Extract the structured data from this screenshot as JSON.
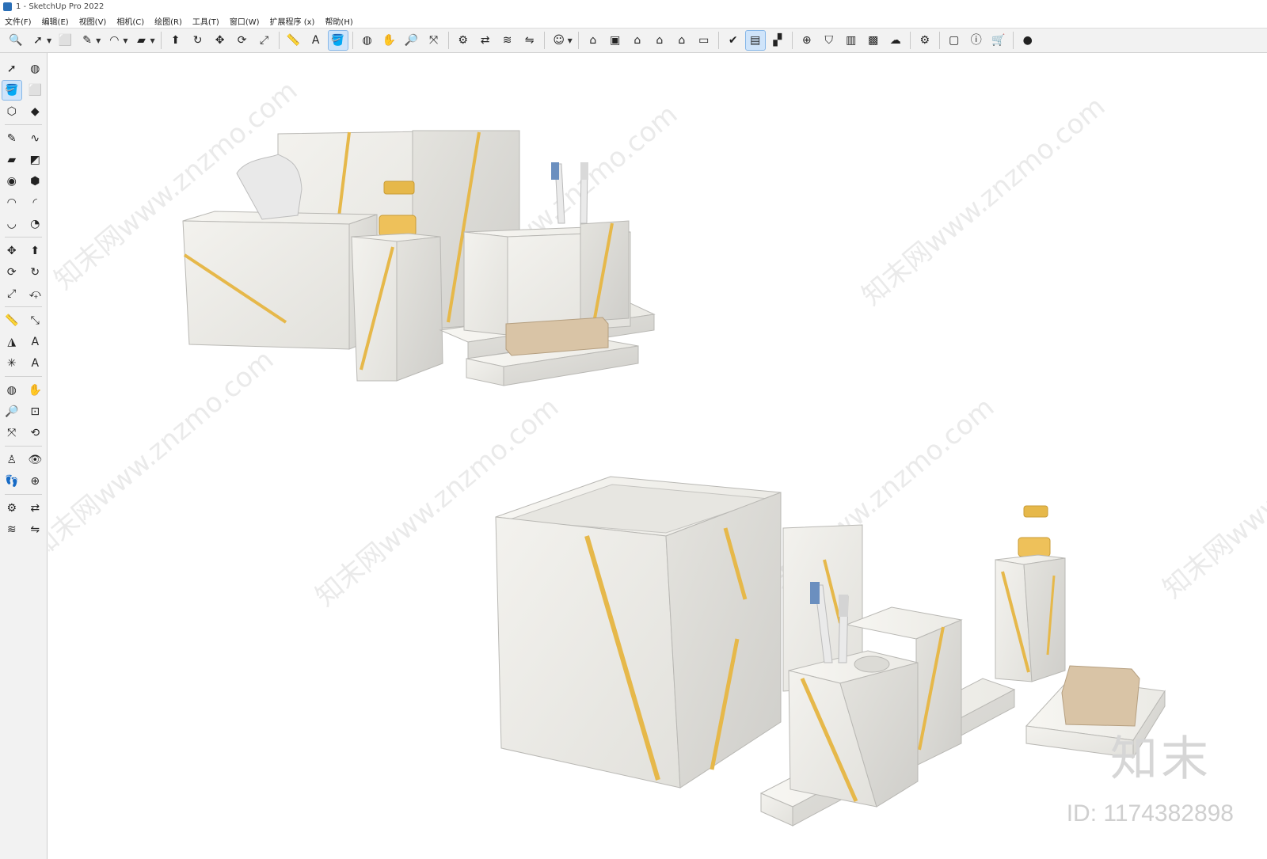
{
  "window": {
    "title": "1 - SketchUp Pro 2022"
  },
  "menu": [
    "文件(F)",
    "编辑(E)",
    "视图(V)",
    "相机(C)",
    "绘图(R)",
    "工具(T)",
    "窗口(W)",
    "扩展程序 (x)",
    "帮助(H)"
  ],
  "toolbar": {
    "buttons": [
      {
        "icon": "zoom-icon",
        "glyph": "🔍"
      },
      {
        "icon": "select-icon",
        "glyph": "➚",
        "caret": true
      },
      {
        "icon": "eraser-icon",
        "glyph": "⬜"
      },
      {
        "icon": "pencil-line-icon",
        "glyph": "✎",
        "caret": true
      },
      {
        "icon": "arc-icon",
        "glyph": "◠",
        "caret": true
      },
      {
        "icon": "rectangle-icon",
        "glyph": "▰",
        "caret": true
      },
      {
        "sep": true
      },
      {
        "icon": "push-pull-icon",
        "glyph": "⬆"
      },
      {
        "icon": "follow-me-icon",
        "glyph": "↻"
      },
      {
        "icon": "move-icon",
        "glyph": "✥"
      },
      {
        "icon": "rotate-icon",
        "glyph": "⟳"
      },
      {
        "icon": "scale-icon",
        "glyph": "⤢"
      },
      {
        "sep": true
      },
      {
        "icon": "tape-measure-icon",
        "glyph": "📏"
      },
      {
        "icon": "text-icon",
        "glyph": "A"
      },
      {
        "icon": "paint-bucket-icon",
        "glyph": "🪣",
        "active": true
      },
      {
        "sep": true
      },
      {
        "icon": "orbit-icon",
        "glyph": "◍"
      },
      {
        "icon": "pan-icon",
        "glyph": "✋"
      },
      {
        "icon": "zoom-tool-icon",
        "glyph": "🔎"
      },
      {
        "icon": "zoom-extents-icon",
        "glyph": "⤧"
      },
      {
        "sep": true
      },
      {
        "icon": "warehouse-icon",
        "glyph": "⚙"
      },
      {
        "icon": "share-model-icon",
        "glyph": "⇄"
      },
      {
        "icon": "component-share-icon",
        "glyph": "≋"
      },
      {
        "icon": "extension-warehouse-icon",
        "glyph": "⇋"
      },
      {
        "sep": true
      },
      {
        "icon": "account-icon",
        "glyph": "☺",
        "caret": true
      },
      {
        "sep": true
      },
      {
        "icon": "iso-view-icon",
        "glyph": "⌂"
      },
      {
        "icon": "top-view-icon",
        "glyph": "▣"
      },
      {
        "icon": "front-view-icon",
        "glyph": "⌂"
      },
      {
        "icon": "right-view-icon",
        "glyph": "⌂"
      },
      {
        "icon": "back-view-icon",
        "glyph": "⌂"
      },
      {
        "icon": "left-view-icon",
        "glyph": "▭"
      },
      {
        "sep": true
      },
      {
        "icon": "style-settings-icon",
        "glyph": "✔"
      },
      {
        "icon": "outliner-icon",
        "glyph": "▤",
        "active": true
      },
      {
        "icon": "scenes-icon",
        "glyph": "▞"
      },
      {
        "sep": true
      },
      {
        "icon": "add-location-icon",
        "glyph": "⊕"
      },
      {
        "icon": "sandbox-icon",
        "glyph": "⛉"
      },
      {
        "icon": "section-plane-icon",
        "glyph": "▥"
      },
      {
        "icon": "texture-icon",
        "glyph": "▩"
      },
      {
        "icon": "cloud-upload-icon",
        "glyph": "☁"
      },
      {
        "sep": true
      },
      {
        "icon": "extension-manager-icon",
        "glyph": "⚙"
      },
      {
        "sep": true
      },
      {
        "icon": "message-icon",
        "glyph": "▢"
      },
      {
        "icon": "info-icon",
        "glyph": "ⓘ"
      },
      {
        "icon": "cart-icon",
        "glyph": "🛒"
      },
      {
        "sep": true
      },
      {
        "icon": "profile-icon",
        "glyph": "●"
      }
    ]
  },
  "left_tools": [
    [
      {
        "icon": "select-icon",
        "glyph": "➚"
      },
      {
        "icon": "orbit-small-icon",
        "glyph": "◍"
      }
    ],
    [
      {
        "icon": "paint-bucket-icon",
        "glyph": "🪣",
        "active": true
      },
      {
        "icon": "eraser-icon",
        "glyph": "⬜"
      }
    ],
    [
      {
        "icon": "make-component-icon",
        "glyph": "⬡"
      },
      {
        "icon": "tag-icon",
        "glyph": "◆"
      }
    ],
    "sep",
    [
      {
        "icon": "line-icon",
        "glyph": "✎"
      },
      {
        "icon": "freehand-icon",
        "glyph": "∿"
      }
    ],
    [
      {
        "icon": "rectangle-icon",
        "glyph": "▰"
      },
      {
        "icon": "rotated-rect-icon",
        "glyph": "◩"
      }
    ],
    [
      {
        "icon": "circle-icon",
        "glyph": "◉"
      },
      {
        "icon": "polygon-icon",
        "glyph": "⬢"
      }
    ],
    [
      {
        "icon": "arc-icon",
        "glyph": "◠"
      },
      {
        "icon": "two-point-arc-icon",
        "glyph": "◜"
      }
    ],
    [
      {
        "icon": "three-point-arc-icon",
        "glyph": "◡"
      },
      {
        "icon": "pie-icon",
        "glyph": "◔"
      }
    ],
    "sep",
    [
      {
        "icon": "move-icon",
        "glyph": "✥"
      },
      {
        "icon": "push-pull-icon",
        "glyph": "⬆"
      }
    ],
    [
      {
        "icon": "rotate-icon",
        "glyph": "⟳"
      },
      {
        "icon": "follow-me-icon",
        "glyph": "↻"
      }
    ],
    [
      {
        "icon": "scale-icon",
        "glyph": "⤢"
      },
      {
        "icon": "offset-icon",
        "glyph": "⤽"
      }
    ],
    "sep",
    [
      {
        "icon": "tape-measure-icon",
        "glyph": "📏"
      },
      {
        "icon": "dimension-icon",
        "glyph": "⤡"
      }
    ],
    [
      {
        "icon": "protractor-icon",
        "glyph": "◮"
      },
      {
        "icon": "text-icon",
        "glyph": "A"
      }
    ],
    [
      {
        "icon": "axes-icon",
        "glyph": "✳"
      },
      {
        "icon": "3d-text-icon",
        "glyph": "A"
      }
    ],
    "sep",
    [
      {
        "icon": "orbit-icon",
        "glyph": "◍"
      },
      {
        "icon": "pan-icon",
        "glyph": "✋"
      }
    ],
    [
      {
        "icon": "zoom-icon",
        "glyph": "🔎"
      },
      {
        "icon": "zoom-window-icon",
        "glyph": "⊡"
      }
    ],
    [
      {
        "icon": "zoom-extents-icon",
        "glyph": "⤧"
      },
      {
        "icon": "previous-view-icon",
        "glyph": "⟲"
      }
    ],
    "sep",
    [
      {
        "icon": "position-camera-icon",
        "glyph": "♙"
      },
      {
        "icon": "look-around-icon",
        "glyph": "👁"
      }
    ],
    [
      {
        "icon": "walk-icon",
        "glyph": "👣"
      },
      {
        "icon": "section-plane-icon",
        "glyph": "⊕"
      }
    ],
    "sep",
    [
      {
        "icon": "warehouse-icon",
        "glyph": "⚙"
      },
      {
        "icon": "share-model-icon",
        "glyph": "⇄"
      }
    ],
    [
      {
        "icon": "component-share-icon",
        "glyph": "≋"
      },
      {
        "icon": "extension-warehouse-icon",
        "glyph": "⇋"
      }
    ]
  ],
  "viewport": {
    "watermarks": [
      "知末网www.znzmo.com"
    ],
    "brand_mark": "知末",
    "asset_id": "ID: 1174382898"
  },
  "colors": {
    "marble": "#ecebe7",
    "marble_shade": "#d6d5d0",
    "gold": "#e6b84a",
    "soap": "#d9c4a6"
  }
}
